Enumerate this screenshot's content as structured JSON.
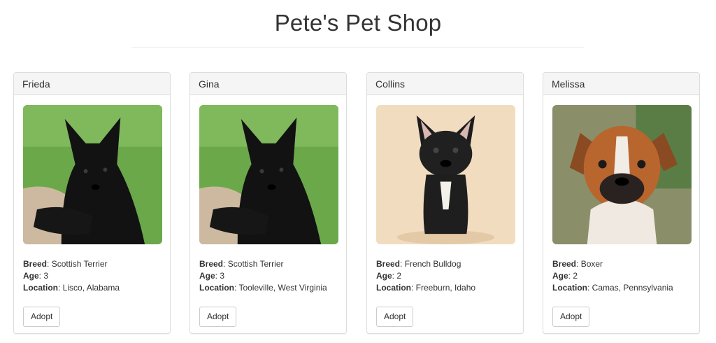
{
  "header": {
    "title": "Pete's Pet Shop"
  },
  "labels": {
    "breed": "Breed",
    "age": "Age",
    "location": "Location",
    "adopt": "Adopt"
  },
  "pets": [
    {
      "name": "Frieda",
      "breed": "Scottish Terrier",
      "age": "3",
      "location": "Lisco, Alabama",
      "photo_icon": "black-scottish-terrier-photo"
    },
    {
      "name": "Gina",
      "breed": "Scottish Terrier",
      "age": "3",
      "location": "Tooleville, West Virginia",
      "photo_icon": "black-scottish-terrier-photo"
    },
    {
      "name": "Collins",
      "breed": "French Bulldog",
      "age": "2",
      "location": "Freeburn, Idaho",
      "photo_icon": "french-bulldog-photo"
    },
    {
      "name": "Melissa",
      "breed": "Boxer",
      "age": "2",
      "location": "Camas, Pennsylvania",
      "photo_icon": "boxer-dog-photo"
    }
  ]
}
